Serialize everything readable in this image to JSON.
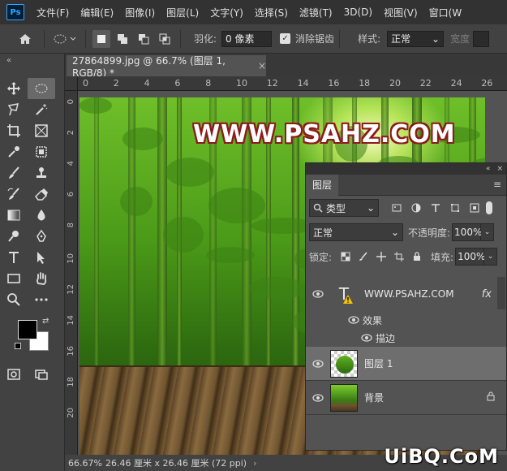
{
  "app": {
    "logo": "Ps"
  },
  "menu": [
    "文件(F)",
    "编辑(E)",
    "图像(I)",
    "图层(L)",
    "文字(Y)",
    "选择(S)",
    "滤镜(T)",
    "3D(D)",
    "视图(V)",
    "窗口(W"
  ],
  "options": {
    "feather_label": "羽化:",
    "feather_value": "0 像素",
    "antialias_label": "消除锯齿",
    "style_label": "样式:",
    "style_value": "正常",
    "width_label": "宽度"
  },
  "toolbox": {
    "collapse": "«"
  },
  "document": {
    "tab_title": "27864899.jpg @ 66.7% (图层 1, RGB/8) *",
    "close": "×"
  },
  "ruler": {
    "top": [
      "0",
      "2",
      "4",
      "6",
      "8",
      "10",
      "12",
      "14",
      "16",
      "18",
      "20",
      "22",
      "24",
      "26"
    ],
    "left": [
      "0",
      "2",
      "4",
      "6",
      "8",
      "10",
      "12",
      "14",
      "16",
      "18",
      "20"
    ]
  },
  "canvas": {
    "text": "WWW.PSAHZ.COM"
  },
  "status": {
    "zoom": "66.67%",
    "info": "26.46 厘米 x 26.46 厘米 (72 ppi)",
    "arrow": "›"
  },
  "layers_panel": {
    "top_icons": [
      "«",
      "×"
    ],
    "tab": "图层",
    "filter": "类型",
    "blend_mode": "正常",
    "opacity_label": "不透明度:",
    "opacity_value": "100%",
    "lock_label": "锁定:",
    "fill_label": "填充:",
    "fill_value": "100%",
    "layers": [
      {
        "name": "WWW.PSAHZ.COM",
        "type": "text",
        "fx": "fx"
      },
      {
        "name": "图层 1",
        "type": "pixel",
        "selected": true
      },
      {
        "name": "背景",
        "type": "background",
        "locked": true
      }
    ],
    "effects_label": "效果",
    "stroke_label": "描边"
  },
  "watermark": "UiBQ.CoM"
}
